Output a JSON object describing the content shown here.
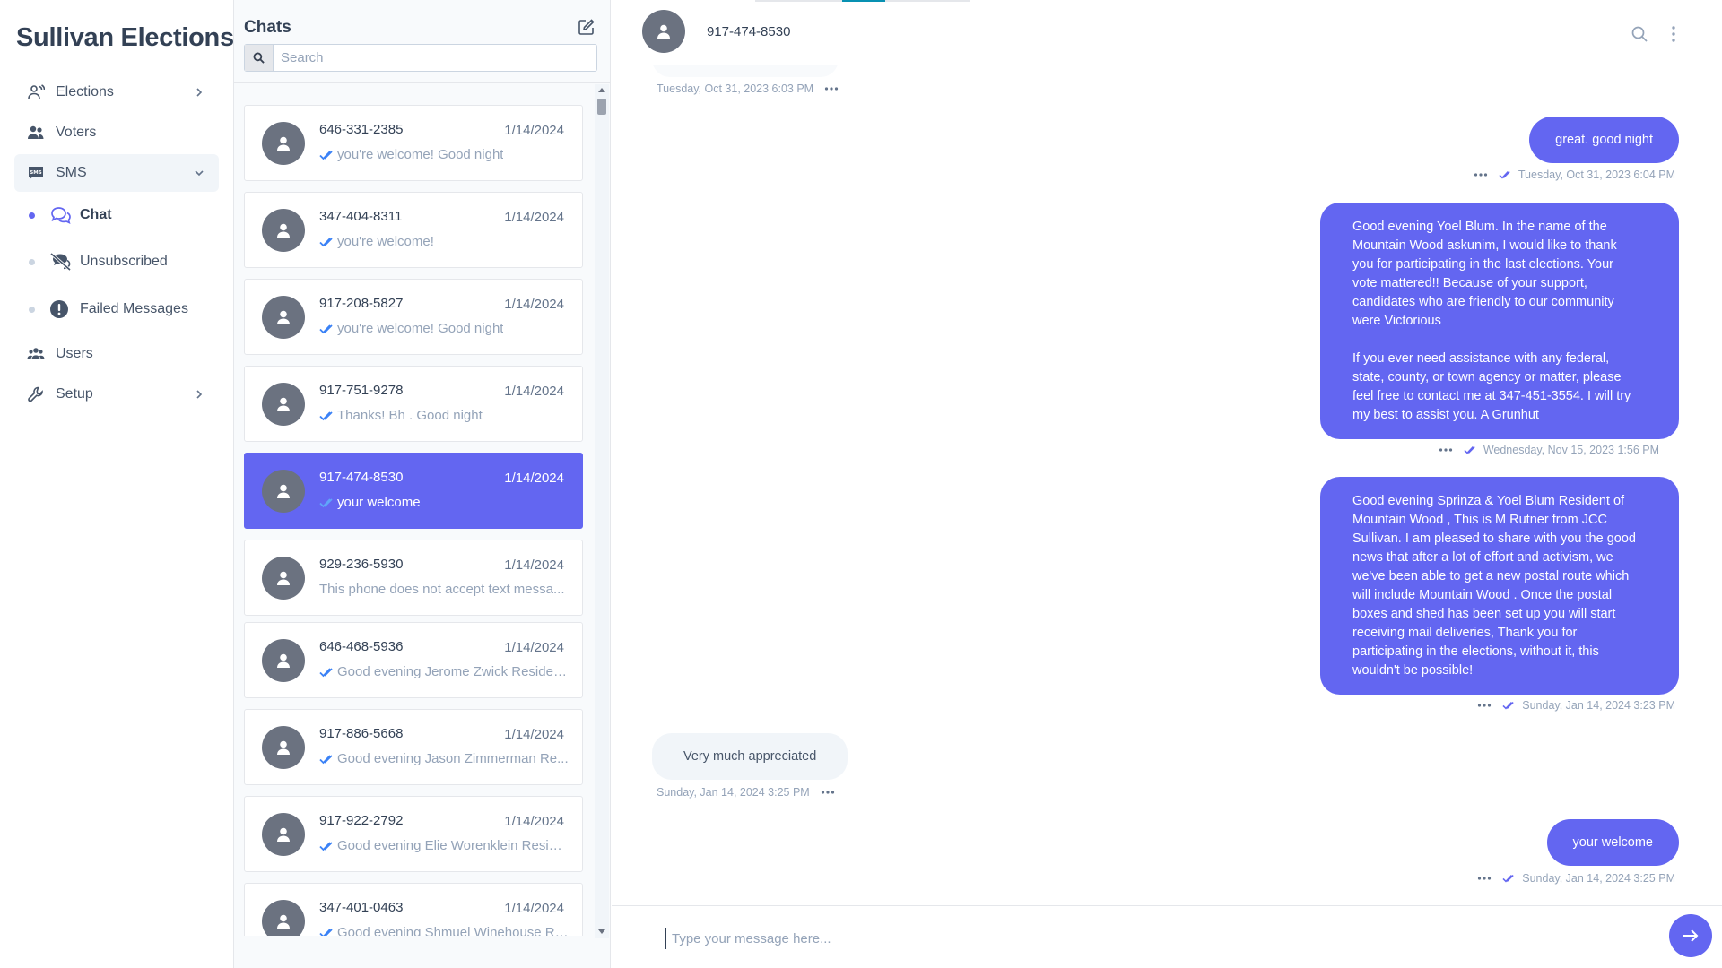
{
  "app": {
    "brand": "Sullivan Elections"
  },
  "nav": {
    "items": [
      {
        "label": "Elections",
        "icon": "elections-icon"
      },
      {
        "label": "Voters",
        "icon": "voters-icon"
      },
      {
        "label": "SMS",
        "icon": "sms-icon"
      },
      {
        "label": "Users",
        "icon": "users-icon"
      },
      {
        "label": "Setup",
        "icon": "wrench-icon"
      }
    ],
    "sms_sub": [
      {
        "label": "Chat",
        "icon": "chat-icon"
      },
      {
        "label": "Unsubscribed",
        "icon": "unsubscribed-icon"
      },
      {
        "label": "Failed Messages",
        "icon": "exclamation-icon"
      }
    ]
  },
  "chats": {
    "title": "Chats",
    "search_placeholder": "Search",
    "rows": [
      {
        "phone": "646-331-2385",
        "date": "1/14/2024",
        "preview": "you're welcome! Good night",
        "read": true
      },
      {
        "phone": "347-404-8311",
        "date": "1/14/2024",
        "preview": "you're welcome!",
        "read": true
      },
      {
        "phone": "917-208-5827",
        "date": "1/14/2024",
        "preview": "you're welcome! Good night",
        "read": true
      },
      {
        "phone": "917-751-9278",
        "date": "1/14/2024",
        "preview": "Thanks! Bh . Good night",
        "read": true
      },
      {
        "phone": "917-474-8530",
        "date": "1/14/2024",
        "preview": "your welcome",
        "read": true
      },
      {
        "phone": "929-236-5930",
        "date": "1/14/2024",
        "preview": "This phone does not accept text messa...",
        "read": false
      },
      {
        "phone": "646-468-5936",
        "date": "1/14/2024",
        "preview": "Good evening Jerome Zwick Residen...",
        "read": true
      },
      {
        "phone": "917-886-5668",
        "date": "1/14/2024",
        "preview": "Good evening Jason Zimmerman Re...",
        "read": true
      },
      {
        "phone": "917-922-2792",
        "date": "1/14/2024",
        "preview": "Good evening Elie Worenklein Reside...",
        "read": true
      },
      {
        "phone": "347-401-0463",
        "date": "1/14/2024",
        "preview": "Good evening Shmuel Winehouse Re...",
        "read": true
      }
    ]
  },
  "conversation": {
    "contact": "917-474-8530",
    "messages": [
      {
        "dir": "in",
        "text": "",
        "time": "Tuesday, Oct 31, 2023 6:03 PM"
      },
      {
        "dir": "out",
        "text": "great. good night",
        "time": "Tuesday, Oct 31, 2023 6:04 PM"
      },
      {
        "dir": "out",
        "text": "Good evening Yoel Blum. In the name of the\nMountain Wood askunim, I would like to thank\nyou for participating in the last elections. Your\nvote mattered!! Because of your support,\ncandidates who are friendly to our community\nwere Victorious\n\nIf you ever need assistance with any federal,\nstate, county, or town agency or matter, please\nfeel free to contact me at 347-451-3554. I will try\nmy best to assist you. A Grunhut",
        "time": "Wednesday, Nov 15, 2023 1:56 PM"
      },
      {
        "dir": "out",
        "text": "Good evening Sprinza & Yoel Blum Resident of\nMountain Wood , This is M Rutner from JCC\nSullivan. I am pleased to share with you the good\nnews that after a lot of effort and activism, we\nwe've been able to get a new postal route which\nwill include Mountain Wood . Once the postal\nboxes and shed has been set up you will start\nreceiving mail deliveries, Thank you for\nparticipating in the elections, without it, this\nwouldn't be possible!",
        "time": "Sunday, Jan 14, 2024 3:23 PM"
      },
      {
        "dir": "in",
        "text": "Very much appreciated",
        "time": "Sunday, Jan 14, 2024 3:25 PM"
      },
      {
        "dir": "out",
        "text": "your welcome",
        "time": "Sunday, Jan 14, 2024 3:25 PM"
      }
    ],
    "composer_placeholder": "Type your message here..."
  },
  "colors": {
    "accent": "#6366f1",
    "avatar": "#6b7280",
    "tick": "#3b82f6"
  }
}
